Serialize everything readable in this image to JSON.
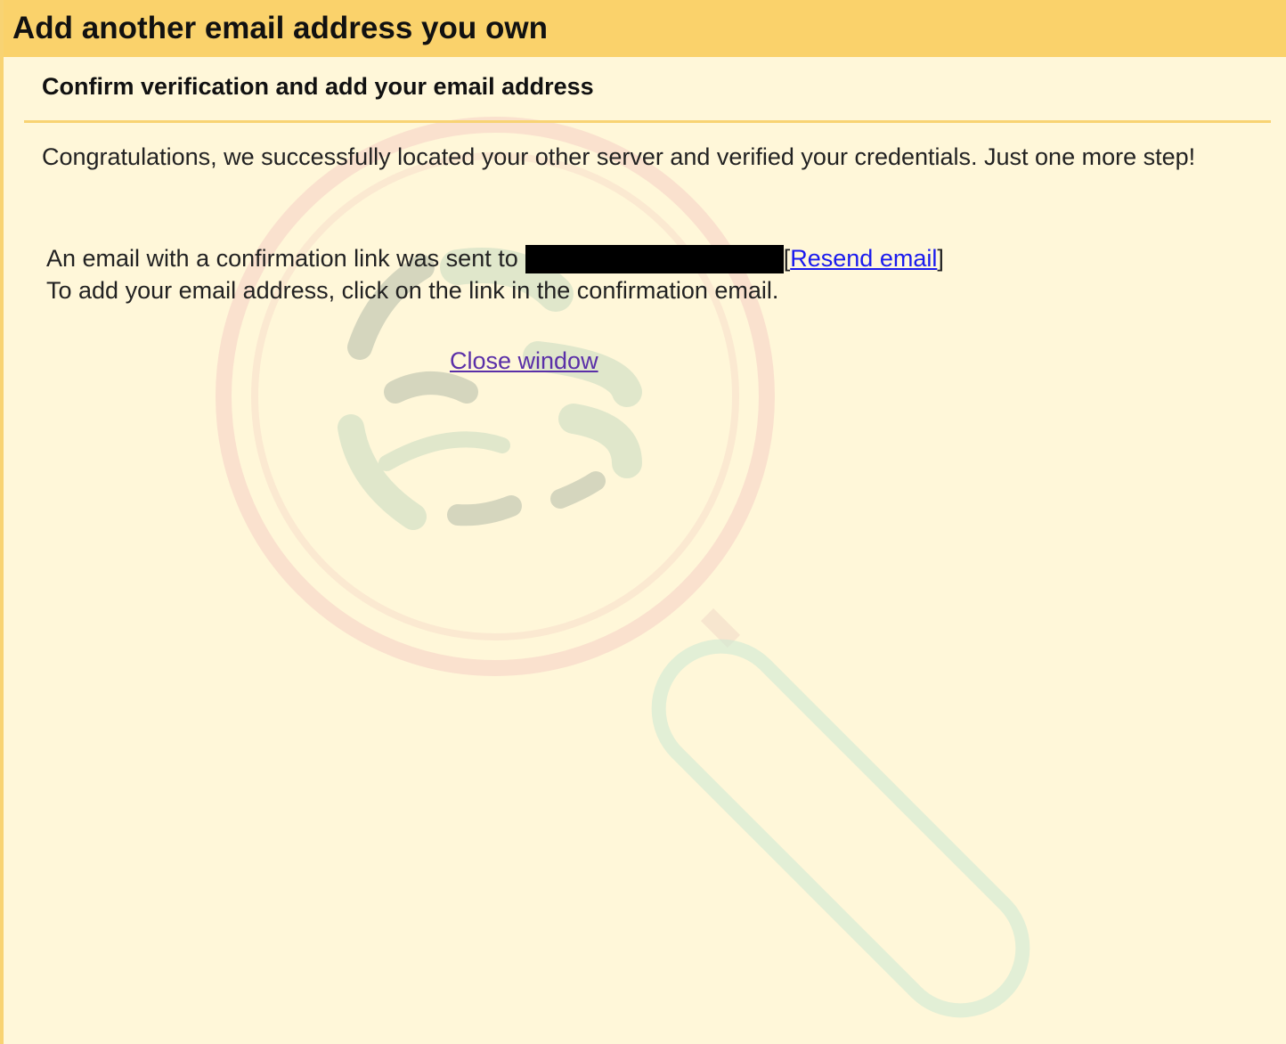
{
  "window": {
    "title": "Add another email address you own"
  },
  "content": {
    "subheading": "Confirm verification and add your email address",
    "intro": "Congratulations, we successfully located your other server and verified your credentials. Just one more step!",
    "sent_prefix": "An email with a confirmation link was sent to",
    "bracket_open": "[",
    "resend_label": "Resend email",
    "bracket_close": "]",
    "instruction": "To add your email address, click on the link in the confirmation email.",
    "close_label": "Close window"
  },
  "colors": {
    "titlebar": "#fad26b",
    "background": "#fff7d9",
    "divider": "#f8d373",
    "link": "#1a1aee",
    "visited_link": "#5a2fa8"
  }
}
